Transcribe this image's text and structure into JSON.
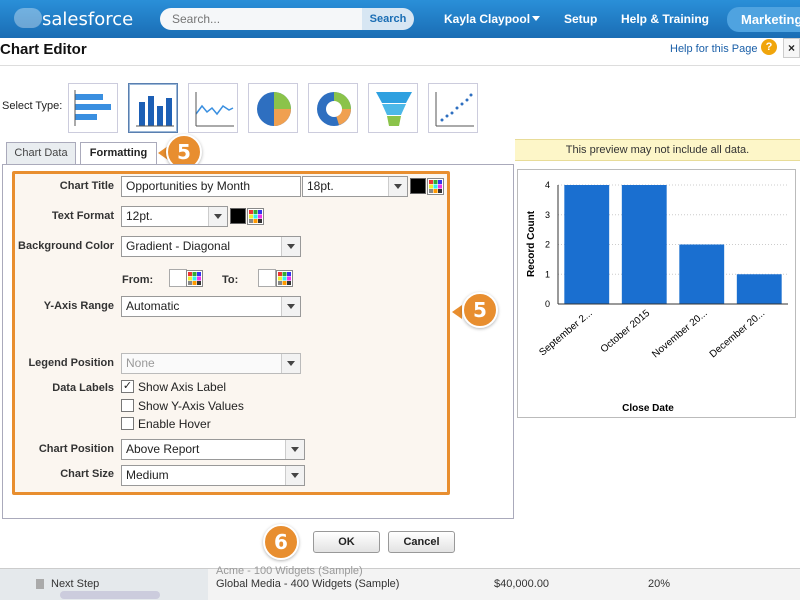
{
  "header": {
    "brand": "salesforce",
    "search_placeholder": "Search...",
    "search_button": "Search",
    "user": "Kayla Claypool",
    "setup": "Setup",
    "help": "Help & Training",
    "app": "Marketing"
  },
  "dialog": {
    "title": "Chart Editor",
    "help_link": "Help for this Page",
    "help_icon": "?",
    "close": "×",
    "select_type_label": "Select Type:",
    "chart_types": [
      "horizontal-bar",
      "vertical-bar",
      "line",
      "pie",
      "donut",
      "funnel",
      "scatter"
    ],
    "selected_type": "vertical-bar",
    "tabs": [
      "Chart Data",
      "Formatting"
    ],
    "active_tab": "Formatting"
  },
  "form": {
    "chart_title_label": "Chart Title",
    "chart_title_value": "Opportunities by Month",
    "chart_title_size": "18pt.",
    "text_format_label": "Text Format",
    "text_format_value": "12pt.",
    "background_color_label": "Background Color",
    "background_color_value": "Gradient - Diagonal",
    "from_label": "From:",
    "to_label": "To:",
    "y_axis_range_label": "Y-Axis Range",
    "y_axis_range_value": "Automatic",
    "legend_position_label": "Legend Position",
    "legend_position_value": "None",
    "data_labels_label": "Data Labels",
    "show_axis_label": "Show Axis Label",
    "show_axis_label_checked": true,
    "show_y_values": "Show Y-Axis Values",
    "show_y_values_checked": false,
    "enable_hover": "Enable Hover",
    "enable_hover_checked": false,
    "chart_position_label": "Chart Position",
    "chart_position_value": "Above Report",
    "chart_size_label": "Chart Size",
    "chart_size_value": "Medium",
    "check_mark": "✓"
  },
  "callouts": {
    "tab_step": "5",
    "panel_step": "5",
    "ok_step": "6"
  },
  "preview": {
    "note": "This preview may not include all data."
  },
  "chart_data": {
    "type": "bar",
    "categories": [
      "September 2...",
      "October 2015",
      "November 20...",
      "December 20..."
    ],
    "values": [
      4,
      4,
      2,
      1
    ],
    "xlabel": "Close Date",
    "ylabel": "Record Count",
    "ylim": [
      0,
      4
    ],
    "yticks": [
      "0",
      "1",
      "2",
      "3",
      "4"
    ],
    "bar_color": "#1a6fd0",
    "grid": true
  },
  "footer": {
    "ok": "OK",
    "cancel": "Cancel"
  },
  "background": {
    "next_step": "Next Step",
    "faded_row": "Acme - 100 Widgets (Sample)",
    "row_name": "Global Media - 400 Widgets (Sample)",
    "row_amount": "$40,000.00",
    "row_pct": "20%"
  },
  "colors": {
    "accent": "#e88e2f",
    "header": "#1a6db4",
    "link": "#1a5fa8"
  }
}
